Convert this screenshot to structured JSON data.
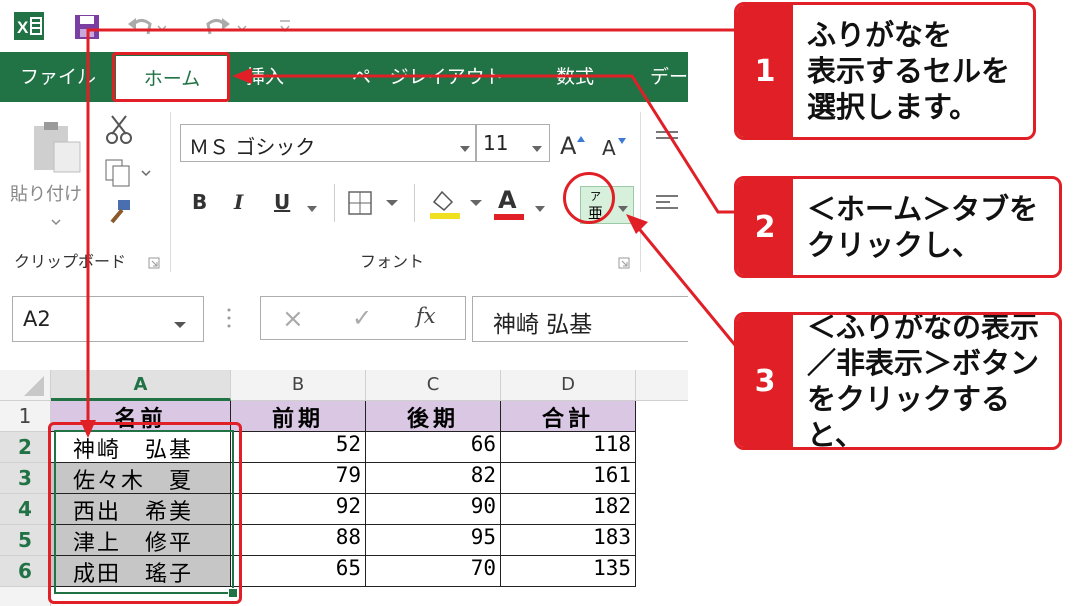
{
  "qat": {
    "app_icon": "excel-icon",
    "save_icon": "save-icon",
    "undo_icon": "undo-icon",
    "redo_icon": "redo-icon",
    "customize_icon": "customize-qat-icon"
  },
  "tabs": [
    {
      "label": "ファイル"
    },
    {
      "label": "ホーム"
    },
    {
      "label": "挿入"
    },
    {
      "label": "ページレイアウト"
    },
    {
      "label": "数式"
    },
    {
      "label": "デー"
    }
  ],
  "ribbon": {
    "paste_label": "貼り付け",
    "clipboard_group": "クリップボード",
    "font_group": "フォント",
    "font_name": "ＭＳ ゴシック",
    "font_size": "11",
    "bold": "B",
    "italic": "I",
    "underline": "U",
    "font_color_letter": "A",
    "grow_font": "A",
    "shrink_font": "A",
    "furigana_label": "ア亜"
  },
  "formula_bar": {
    "name_box": "A2",
    "fx": "fx",
    "cancel": "×",
    "enter": "✓",
    "content": "神崎 弘基"
  },
  "sheet": {
    "columns": [
      "A",
      "B",
      "C",
      "D"
    ],
    "header_row": {
      "row": "1",
      "cells": [
        "名前",
        "前期",
        "後期",
        "合計"
      ]
    },
    "rows": [
      {
        "row": "2",
        "name": "神崎　弘基",
        "b": "52",
        "c": "66",
        "d": "118"
      },
      {
        "row": "3",
        "name": "佐々木　夏",
        "b": "79",
        "c": "82",
        "d": "161"
      },
      {
        "row": "4",
        "name": "西出　希美",
        "b": "92",
        "c": "90",
        "d": "182"
      },
      {
        "row": "5",
        "name": "津上　修平",
        "b": "88",
        "c": "95",
        "d": "183"
      },
      {
        "row": "6",
        "name": "成田　瑤子",
        "b": "65",
        "c": "70",
        "d": "135"
      }
    ]
  },
  "callouts": [
    {
      "num": "1",
      "lines": [
        "ふりがなを",
        "表示するセルを",
        "選択します。"
      ]
    },
    {
      "num": "2",
      "lines": [
        "＜ホーム＞タブを",
        "クリックし、"
      ]
    },
    {
      "num": "3",
      "lines": [
        "＜ふりがなの表示",
        "／非表示＞ボタン",
        "をクリックすると、"
      ]
    }
  ],
  "colors": {
    "excel_green": "#217346",
    "accent_red": "#e01f26",
    "header_fill": "#d9c7e3",
    "name_fill": "#c6c6c6"
  }
}
